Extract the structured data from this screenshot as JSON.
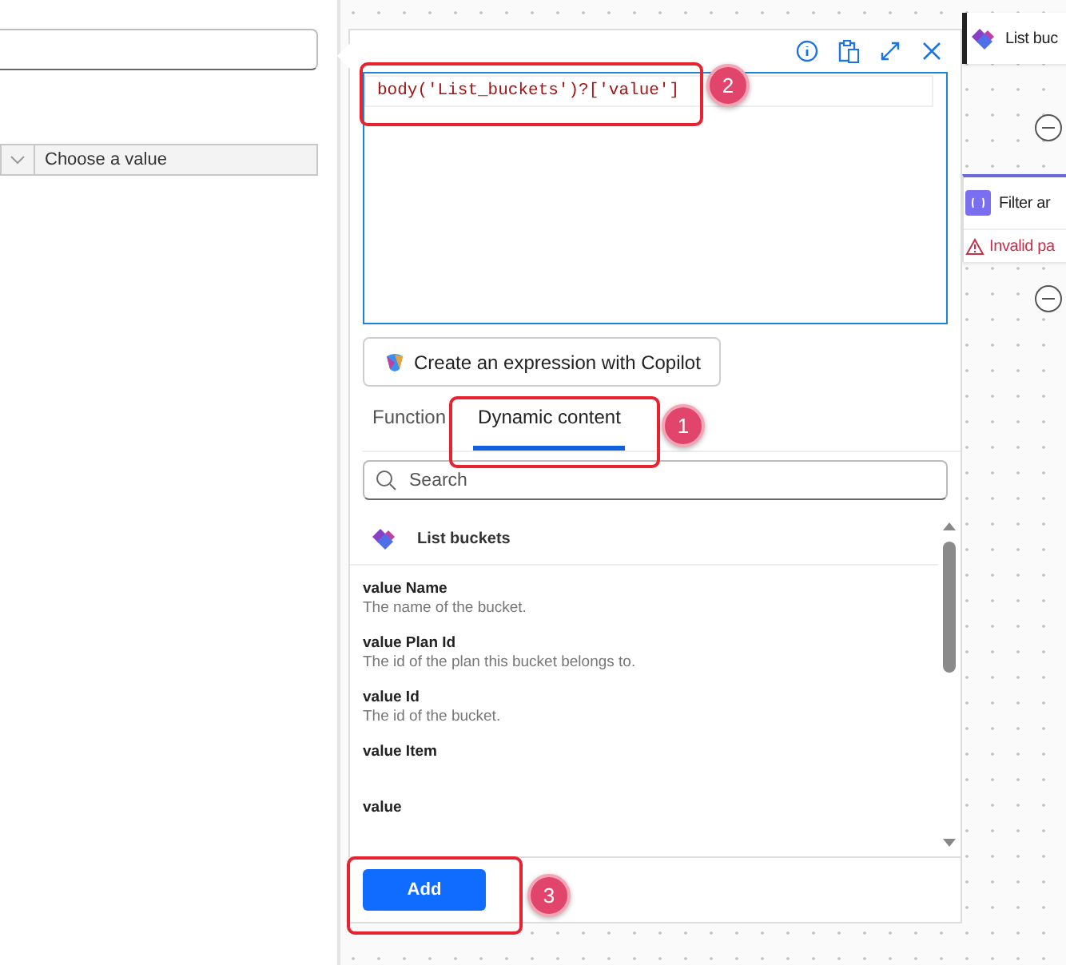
{
  "left_panel": {
    "value_field": {
      "placeholder": "Choose a value"
    }
  },
  "expression_editor": {
    "expression": "body('List_buckets')?['value']",
    "copilot_button": "Create an expression with Copilot",
    "tabs": [
      {
        "label": "Function",
        "selected": false
      },
      {
        "label": "Dynamic content",
        "selected": true
      }
    ],
    "search": {
      "placeholder": "Search"
    },
    "group": {
      "title": "List buckets",
      "items": [
        {
          "name": "value Name",
          "description": "The name of the bucket."
        },
        {
          "name": "value Plan Id",
          "description": "The id of the plan this bucket belongs to."
        },
        {
          "name": "value Id",
          "description": "The id of the bucket."
        },
        {
          "name": "value Item"
        },
        {
          "name": "value"
        }
      ]
    },
    "add_button": "Add"
  },
  "canvas_cards": [
    {
      "kind": "action",
      "title": "List buc"
    },
    {
      "kind": "error",
      "title": "Filter ar",
      "error": "Invalid pa"
    }
  ],
  "annotations": [
    {
      "label": "2"
    },
    {
      "label": "1"
    },
    {
      "label": "3"
    }
  ]
}
